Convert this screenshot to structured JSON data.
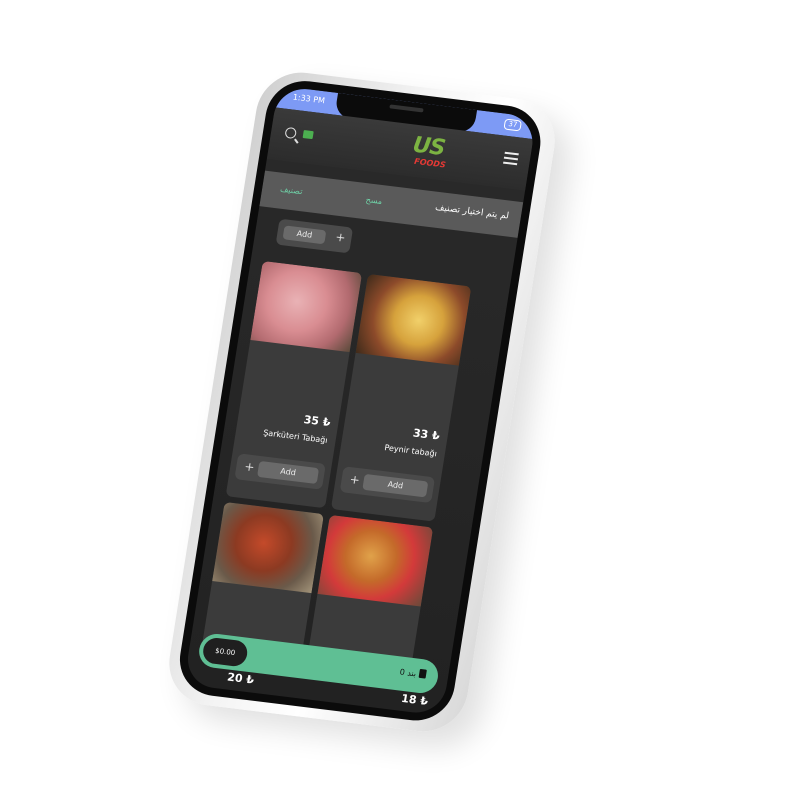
{
  "status": {
    "time": "1:33 PM",
    "battery": "37"
  },
  "header": {
    "logo_top": "US",
    "logo_bottom": "FOODS"
  },
  "filter": {
    "classify": "تصنيف",
    "clear": "مسح",
    "none_selected": "لم يتم اختيار تصنيف"
  },
  "actions": {
    "add": "Add",
    "plus": "+"
  },
  "products": [
    {
      "name": "Şarküteri Tabağı",
      "price": "35 ₺"
    },
    {
      "name": "Peynir tabağı",
      "price": "33 ₺"
    },
    {
      "name": "",
      "price": "20 ₺"
    },
    {
      "name": "",
      "price": "18 ₺"
    }
  ],
  "cart": {
    "total": "$0.00",
    "count": "0 بند"
  },
  "colors": {
    "accent": "#5fbf94",
    "status_bar": "#7d9af5",
    "screen_bg": "#2a2a2a"
  }
}
